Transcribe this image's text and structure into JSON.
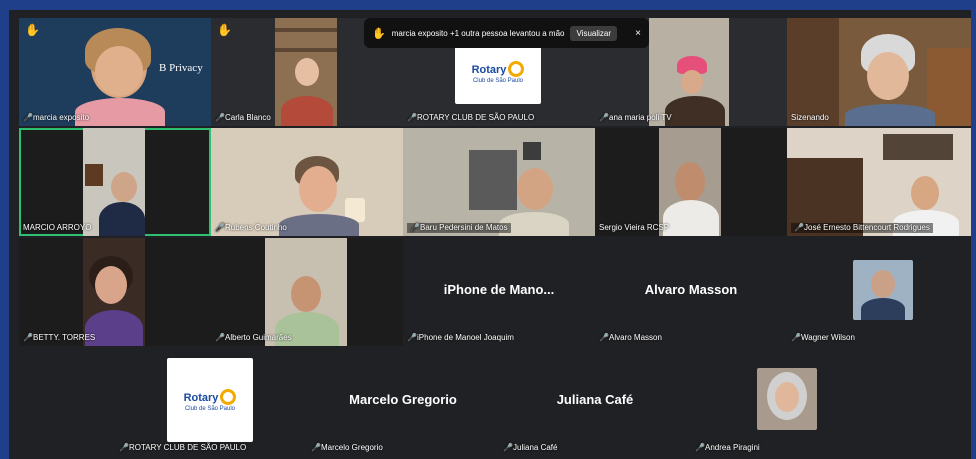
{
  "notification": {
    "hand_icon": "raised-hand-icon",
    "text": "marcia exposito +1 outra pessoa levantou a mão",
    "view_label": "Visualizar",
    "close_label": "×"
  },
  "participants": [
    {
      "name": "marcia exposito",
      "hand_raised": true,
      "video": true,
      "logo_text": "B Privacy"
    },
    {
      "name": "Carla Blanco",
      "hand_raised": true,
      "video": true
    },
    {
      "name": "ROTARY CLUB DE SÃO PAULO",
      "video": false,
      "logo": {
        "title": "Rotary",
        "subtitle": "Club de São Paulo"
      }
    },
    {
      "name": "ana maria poli TV",
      "video": true
    },
    {
      "name": "Sizenando",
      "video": true
    },
    {
      "name": "MARCIO ARROYO",
      "video": true,
      "active_speaker": true
    },
    {
      "name": "Rubens Coutinho",
      "video": true
    },
    {
      "name": "Baru Pedersini de Matos",
      "video": true
    },
    {
      "name": "Sergio Vieira RCSP",
      "video": true
    },
    {
      "name": "José Ernesto Bittencourt Rodrigues",
      "video": true
    },
    {
      "name": "BETTY. TORRES",
      "video": true
    },
    {
      "name": "Alberto Guimarães",
      "video": true
    },
    {
      "name": "iPhone de Manoel Joaquim",
      "video": false,
      "display": "iPhone de Mano..."
    },
    {
      "name": "Alvaro Masson",
      "video": false,
      "display": "Alvaro Masson"
    },
    {
      "name": "Wagner Wilson",
      "video": false
    },
    {
      "name": "ROTARY CLUB DE SÃO PAULO",
      "video": false,
      "logo": {
        "title": "Rotary",
        "subtitle": "Club de São Paulo"
      }
    },
    {
      "name": "Marcelo Gregorio",
      "video": false,
      "display": "Marcelo Gregorio"
    },
    {
      "name": "Juliana Café",
      "video": false,
      "display": "Juliana Café"
    },
    {
      "name": "Andrea Piragini",
      "video": false
    }
  ],
  "colors": {
    "active_border": "#2fbf71",
    "mic_muted": "#e53935",
    "hand": "#f6c000",
    "rotary_blue": "#1b4aa0",
    "rotary_gold": "#f2a900"
  }
}
